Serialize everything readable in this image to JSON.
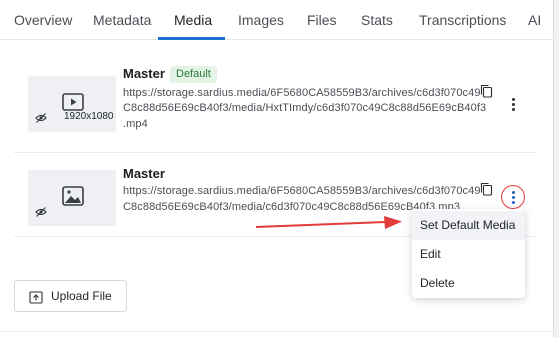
{
  "tabs": [
    {
      "label": "Overview"
    },
    {
      "label": "Metadata"
    },
    {
      "label": "Media"
    },
    {
      "label": "Images"
    },
    {
      "label": "Files"
    },
    {
      "label": "Stats"
    },
    {
      "label": "Transcriptions"
    },
    {
      "label": "AI"
    }
  ],
  "active_tab": "Media",
  "media_items": [
    {
      "title": "Master",
      "badge": "Default",
      "resolution": "1920x1080",
      "type_icon": "video-icon",
      "url_lines": [
        "https://storage.sardius.media/6F5680CA58559B3/archives/c6d3f070c49",
        "C8c88d56E69cB40f3/media/HxtTImdy/c6d3f070c49C8c88d56E69cB40f3",
        ".mp4"
      ]
    },
    {
      "title": "Master",
      "type_icon": "image-icon",
      "url_lines": [
        "https://storage.sardius.media/6F5680CA58559B3/archives/c6d3f070c49",
        "C8c88d56E69cB40f3/media/c6d3f070c49C8c88d56E69cB40f3.mp3"
      ]
    }
  ],
  "context_menu": {
    "items": [
      {
        "label": "Set Default Media"
      },
      {
        "label": "Edit"
      },
      {
        "label": "Delete"
      }
    ]
  },
  "upload_button": {
    "label": "Upload File"
  },
  "colors": {
    "accent": "#1f6fd0",
    "badge_bg": "#e3f4e6",
    "badge_text": "#2c7a3c",
    "highlight": "#e23b3b"
  }
}
